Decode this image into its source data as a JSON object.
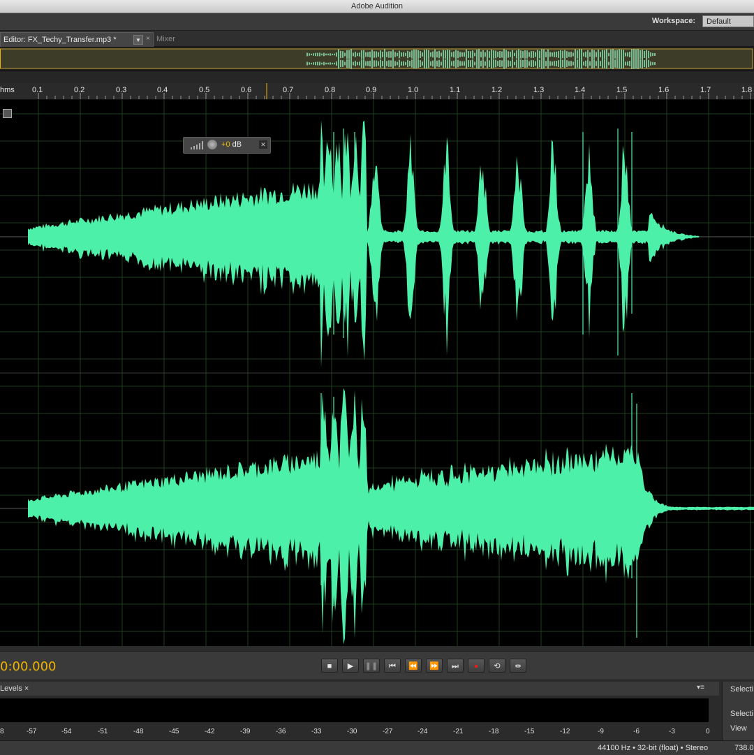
{
  "app": {
    "title": "Adobe Audition"
  },
  "workspace": {
    "label": "Workspace:",
    "value": "Default"
  },
  "tabs": {
    "editor_label": "Editor: FX_Techy_Transfer.mp3 *",
    "mixer_label": "Mixer",
    "dropdown_glyph": "▼",
    "close_glyph": "×"
  },
  "ruler": {
    "unit_label": "hms",
    "ticks": [
      "0.1",
      "0.2",
      "0.3",
      "0.4",
      "0.5",
      "0.6",
      "0.7",
      "0.8",
      "0.9",
      "1.0",
      "1.1",
      "1.2",
      "1.3",
      "1.4",
      "1.5",
      "1.6",
      "1.7",
      "1.8"
    ]
  },
  "hud": {
    "sign": "+",
    "value": "0",
    "unit": "dB"
  },
  "transport": {
    "timecode": "0:00.000",
    "buttons": [
      "stop",
      "play",
      "pause",
      "go-to-start",
      "rewind",
      "fast-forward",
      "go-to-end",
      "record",
      "loop",
      "skip-selection"
    ]
  },
  "levels": {
    "panel_label": "Levels",
    "close_glyph": "×",
    "scale": [
      "-57",
      "-54",
      "-51",
      "-48",
      "-45",
      "-42",
      "-39",
      "-36",
      "-33",
      "-30",
      "-27",
      "-24",
      "-21",
      "-18",
      "-15",
      "-12",
      "-9",
      "-6",
      "-3",
      "0"
    ],
    "scale_left_partial": "8"
  },
  "right_panel": {
    "header": "Selecti",
    "row1": "Selecti",
    "row2": "View"
  },
  "status": {
    "format": "44100 Hz • 32-bit (float) • Stereo",
    "size": "738.0"
  },
  "colors": {
    "waveform": "#4df0a8",
    "timecode": "#f0b400",
    "background": "#000000"
  }
}
